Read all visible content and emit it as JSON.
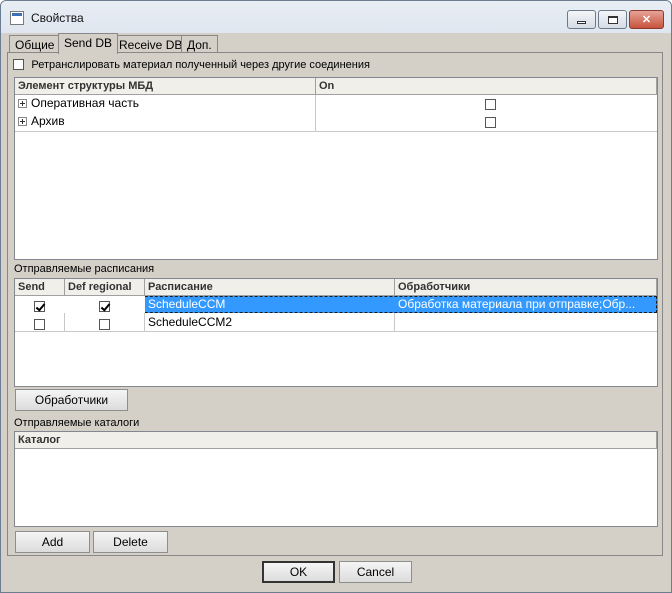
{
  "window": {
    "title": "Свойства"
  },
  "tabs": [
    {
      "label": "Общие"
    },
    {
      "label": "Send DB"
    },
    {
      "label": "Receive DB"
    },
    {
      "label": "Доп."
    }
  ],
  "relay_option": {
    "label": "Ретранслировать материал полученный через другие соединения",
    "checked": false
  },
  "structure_grid": {
    "columns": [
      "Элемент структуры МБД",
      "On"
    ],
    "rows": [
      {
        "name": "Оперативная часть",
        "on": false
      },
      {
        "name": "Архив",
        "on": false
      }
    ]
  },
  "schedules": {
    "label": "Отправляемые расписания",
    "columns": [
      "Send",
      "Def regional",
      "Расписание",
      "Обработчики"
    ],
    "rows": [
      {
        "send": true,
        "def_regional": true,
        "schedule": "ScheduleCCM",
        "handlers": "Обработка материала при отправке;Обр...",
        "selected": true
      },
      {
        "send": false,
        "def_regional": false,
        "schedule": "ScheduleCCM2",
        "handlers": "",
        "selected": false
      }
    ],
    "handlers_button": "Обработчики"
  },
  "catalogs": {
    "label": "Отправляемые каталоги",
    "columns": [
      "Каталог"
    ],
    "add_button": "Add",
    "delete_button": "Delete"
  },
  "footer": {
    "ok": "OK",
    "cancel": "Cancel"
  },
  "colors": {
    "selection": "#3399ff",
    "window_bg": "#d4d0c8"
  }
}
